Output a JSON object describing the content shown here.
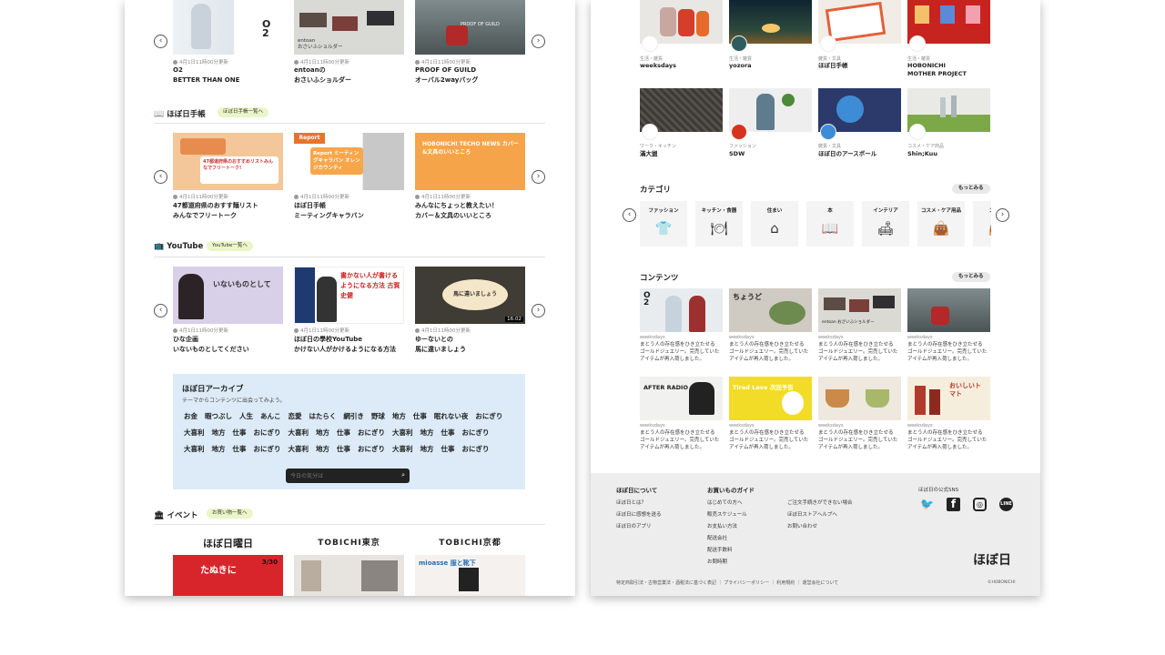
{
  "left": {
    "products": [
      {
        "meta": "4月1日11時00分更新",
        "line1": "O2",
        "line2": "BETTER THAN ONE",
        "img_text": "O\n2"
      },
      {
        "meta": "4月1日11時00分更新",
        "line1": "entoanの",
        "line2": "おさいふショルダー",
        "img_text": "entoan\nおさいふショルダー"
      },
      {
        "meta": "4月1日11時00分更新",
        "line1": "PROOF OF GUILD",
        "line2": "オーバル2wayバッグ",
        "img_text": "PROOF OF GUILD"
      }
    ],
    "techo": {
      "title": "ほぼ日手帳",
      "pill": "ほぼ日手帳一覧へ",
      "items": [
        {
          "meta": "4月1日11時00分更新",
          "line1": "47都道府県のおすす麺リスト",
          "line2": "みんなでフリートーク",
          "img_text": "47都道府県のおすすめリストみんなでフリートーク!"
        },
        {
          "meta": "4月1日11時00分更新",
          "line1": "ほぼ日手帳",
          "line2": "ミーティングキャラバン",
          "img_text": "Report ミーティングキャラバン オレンジカウンティ"
        },
        {
          "meta": "4月1日11時00分更新",
          "line1": "みんなにちょっと教えたい！",
          "line2": "カバー＆文具のいいところ",
          "img_text": "HOBONICHI TECHO NEWS カバー&文具のいいところ"
        }
      ]
    },
    "youtube": {
      "title": "YouTube",
      "pill": "YouTube一覧へ",
      "items": [
        {
          "meta": "4月1日11時00分更新",
          "line1": "ひな企画",
          "line2": "いないものとしてください",
          "img_text": "いないものとして"
        },
        {
          "meta": "4月1日11時00分更新",
          "line1": "ほぼ日の學校YouTube",
          "line2": "かけない人がかけるようになる方法",
          "img_text": "書かない人が書けるようになる方法 古賀史健"
        },
        {
          "meta": "4月1日11時00分更新",
          "line1": "ゆーないとの",
          "line2": "馬に違いましょう",
          "img_text": "馬に違いましょう",
          "duration": "16:02"
        }
      ]
    },
    "archive": {
      "title": "ほぼ日アーカイブ",
      "subtitle": "テーマからコンテンツに出会ってみよう。",
      "rows": [
        [
          "お金",
          "暇つぶし",
          "人生",
          "あんこ",
          "恋愛",
          "はたらく",
          "網引き",
          "野球",
          "地方",
          "仕事",
          "眠れない夜",
          "おにぎり"
        ],
        [
          "大喜利",
          "地方",
          "仕事",
          "おにぎり",
          "大喜利",
          "地方",
          "仕事",
          "おにぎり",
          "大喜利",
          "地方",
          "仕事",
          "おにぎり"
        ],
        [
          "大喜利",
          "地方",
          "仕事",
          "おにぎり",
          "大喜利",
          "地方",
          "仕事",
          "おにぎり",
          "大喜利",
          "地方",
          "仕事",
          "おにぎり"
        ]
      ],
      "search_placeholder": "今日の気分は"
    },
    "event": {
      "title": "イベント",
      "pill": "お買い物一覧へ",
      "venues": [
        "ほぼ日曜日",
        "TOBICHI東京",
        "TOBICHI京都"
      ],
      "img_texts": [
        "たぬきに",
        "",
        "mioasse 服と靴下"
      ],
      "date": "3/30"
    }
  },
  "right": {
    "brands_row1": [
      {
        "cat": "生活・雑貨",
        "name": "weeksdays",
        "logo": "weeksdays"
      },
      {
        "cat": "生活・雑貨",
        "name": "yozora",
        "logo": "yozora"
      },
      {
        "cat": "雑貨・文具",
        "name": "ほぼ日手帳",
        "logo": "手帳"
      },
      {
        "cat": "生活・雑貨",
        "name": "HOBONICHI",
        "name2": "MOTHER PROJECT",
        "logo": "MOTHER"
      }
    ],
    "brands_row2": [
      {
        "cat": "ワーク・キッチン",
        "name": "滿大盥",
        "logo": ""
      },
      {
        "cat": "ファッション",
        "name": "SDW",
        "logo": "SDW"
      },
      {
        "cat": "雑貨・文具",
        "name": "ほぼ日のアースボール",
        "logo": ""
      },
      {
        "cat": "コスメ・ケア商品",
        "name": "Shin;Kuu",
        "logo": ""
      }
    ],
    "category": {
      "title": "カテゴリ",
      "more": "もっとみる",
      "items": [
        {
          "label": "ファッション",
          "icon": "shirt-icon"
        },
        {
          "label": "キッチン・食器",
          "icon": "plate-icon"
        },
        {
          "label": "住まい",
          "icon": "house-icon"
        },
        {
          "label": "本",
          "icon": "book-icon"
        },
        {
          "label": "インテリア",
          "icon": "sofa-icon"
        },
        {
          "label": "コスメ・ケア用品",
          "icon": "bag-icon"
        },
        {
          "label": "コスメ",
          "icon": "bag-icon"
        }
      ]
    },
    "contents": {
      "title": "コンテンツ",
      "more": "もっとみる",
      "source": "weeksdays",
      "desc1": "まとう人の存在感をひき立たせる",
      "desc2": "ゴールドジュエリー。完売していた",
      "desc3": "アイテムが再入荷しました。",
      "img_texts": [
        "O\n2",
        "ちょうど",
        "entoan おさいふショルダー",
        "",
        "AFTER RADIO",
        "Tired Love 次回予告",
        "",
        "おいしいトマト"
      ]
    },
    "footer": {
      "col1_head": "ほぼ日について",
      "col1": [
        "ほぼ日とは？",
        "ほぼ日に感想を送る",
        "ほぼ日のアプリ"
      ],
      "col2_head": "お買いものガイド",
      "col2": [
        "はじめての方へ",
        "販売スケジュール",
        "お支払い方法",
        "配送会社",
        "配送手数料",
        "お問時期"
      ],
      "col3": [
        "ご注文手続きができない場合",
        "ほぼ日ストアヘルプへ",
        "お問い合わせ"
      ],
      "sns_head": "ほぼ日の公式SNS",
      "logo": "ほぼ日",
      "bottom": "特定商取引法・古物営業法・酒税法に基づく表記 ｜ プライバシーポリシー ｜ 利用規約 ｜ 運営会社について",
      "copyright": "©HOBONICHI"
    }
  },
  "colors": {
    "archive_bg": "#dcebf7",
    "pill_green": "#eaf6c8",
    "footer_bg": "#ededed"
  }
}
